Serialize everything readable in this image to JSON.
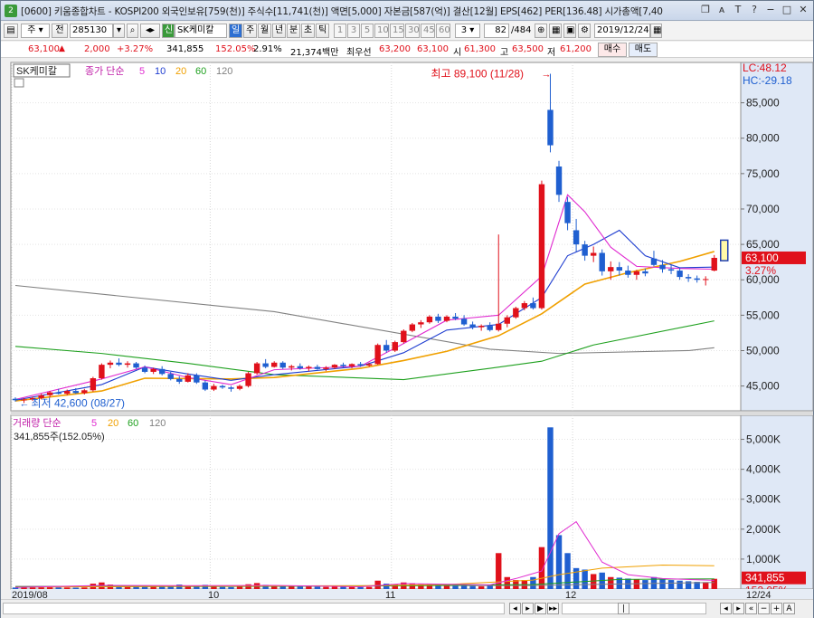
{
  "title": "[0600] 키움종합차트 - KOSPI200 외국인보유[759(천)] 주식수[11,741(천)] 액면[5,000] 자본금[587(억)] 결산[12월] EPS[462] PER[136.48] 시가총액[7,40",
  "window_num": "2",
  "toolbar": {
    "period_mode": "주",
    "jeon": "전",
    "code": "285130",
    "badge": "신",
    "name": "SK케미칼",
    "day": "일",
    "week": "주",
    "month": "월",
    "year": "년",
    "minute": "분",
    "second": "초",
    "tick": "틱",
    "intervals": [
      "1",
      "3",
      "5",
      "10",
      "15",
      "30",
      "45",
      "60"
    ],
    "interval_sel": "3",
    "count": "82",
    "total": "/484",
    "date": "2019/12/24",
    "buy": "매수",
    "sell": "매도"
  },
  "info": {
    "price": "63,100",
    "arrow": "▲",
    "change": "2,000",
    "pct": "+3.27%",
    "volume": "341,855",
    "vol_ratio": "152.05%",
    "turnover": "2.91%",
    "amount": "21,374백만",
    "best_label": "최우선",
    "bid1": "63,200",
    "bid2": "63,100",
    "open_label": "시",
    "open": "61,300",
    "high_label": "고",
    "high": "63,500",
    "low_label": "저",
    "low": "61,200"
  },
  "price_panel": {
    "name_box": "SK케미칼",
    "legend_prefix": "종가 단순",
    "ma": [
      "5",
      "10",
      "20",
      "60",
      "120"
    ],
    "lc": "LC:48.12",
    "hc": "HC:-29.18",
    "max_label": "최고 89,100 (11/28)",
    "min_label": "최저 42,600 (08/27)",
    "cur_price": "63,100",
    "cur_pct": "3.27%"
  },
  "volume_panel": {
    "legend_prefix": "거래량 단순",
    "ma": [
      "5",
      "20",
      "60",
      "120"
    ],
    "cur_text": "341,855주(152.05%)",
    "cur_vol": "341,855",
    "cur_pct": "152.05%"
  },
  "x_labels": [
    "2019/08",
    "10",
    "11",
    "12",
    "12/24"
  ],
  "colors": {
    "up": "#e0111b",
    "down": "#1f5fd0",
    "ma5": "#e02ad0",
    "ma10": "#1e3dd0",
    "ma20": "#f0a000",
    "ma60": "#1ea01e",
    "ma120": "#808080"
  },
  "chart_data": {
    "type": "candlestick",
    "price_axis": {
      "ticks": [
        45000,
        50000,
        55000,
        60000,
        65000,
        70000,
        75000,
        80000,
        85000
      ],
      "tick_labels": [
        "45,000",
        "50,000",
        "55,000",
        "60,000",
        "65,000",
        "70,000",
        "75,000",
        "80,000",
        "85,000"
      ],
      "range": [
        41500,
        90700
      ]
    },
    "volume_axis": {
      "ticks": [
        1000000,
        2000000,
        3000000,
        4000000,
        5000000
      ],
      "tick_labels": [
        "1,000K",
        "2,000K",
        "3,000K",
        "4,000K",
        "5,000K"
      ],
      "range": [
        0,
        5500000
      ]
    },
    "candles": [
      [
        43200,
        43400,
        42800,
        43000
      ],
      [
        43000,
        43300,
        42600,
        43100
      ],
      [
        43100,
        43500,
        42900,
        43300
      ],
      [
        43300,
        43900,
        43100,
        43700
      ],
      [
        43700,
        44300,
        43400,
        44100
      ],
      [
        44100,
        44600,
        43800,
        43900
      ],
      [
        43900,
        44500,
        43700,
        44300
      ],
      [
        44300,
        44700,
        43900,
        44000
      ],
      [
        44000,
        44600,
        43800,
        44400
      ],
      [
        44400,
        46300,
        44200,
        46100
      ],
      [
        46100,
        48200,
        45900,
        48000
      ],
      [
        48000,
        48600,
        47500,
        48300
      ],
      [
        48300,
        48900,
        47800,
        48000
      ],
      [
        48000,
        48500,
        47600,
        48200
      ],
      [
        48200,
        48400,
        47400,
        47600
      ],
      [
        47600,
        47900,
        46800,
        47000
      ],
      [
        47000,
        47600,
        46700,
        47400
      ],
      [
        47400,
        47800,
        46500,
        46700
      ],
      [
        46700,
        47000,
        45800,
        46000
      ],
      [
        46000,
        46400,
        45300,
        45600
      ],
      [
        45600,
        46800,
        45500,
        46500
      ],
      [
        46500,
        46800,
        45300,
        45500
      ],
      [
        45500,
        45800,
        44300,
        44500
      ],
      [
        44500,
        45300,
        44300,
        45000
      ],
      [
        45000,
        45200,
        44600,
        44800
      ],
      [
        44800,
        45000,
        44200,
        44600
      ],
      [
        44600,
        45200,
        44400,
        45000
      ],
      [
        45000,
        47000,
        44800,
        46800
      ],
      [
        46800,
        48400,
        46600,
        48200
      ],
      [
        48200,
        48800,
        47500,
        47700
      ],
      [
        47700,
        48500,
        47600,
        48300
      ],
      [
        48300,
        48500,
        47400,
        47600
      ],
      [
        47600,
        48000,
        47200,
        47800
      ],
      [
        47800,
        48200,
        47300,
        47500
      ],
      [
        47500,
        47900,
        47100,
        47700
      ],
      [
        47700,
        48000,
        47300,
        47400
      ],
      [
        47400,
        47800,
        47100,
        47600
      ],
      [
        47600,
        48100,
        47400,
        48000
      ],
      [
        48000,
        48300,
        47600,
        47800
      ],
      [
        47800,
        48200,
        47500,
        48100
      ],
      [
        48100,
        48400,
        47700,
        47900
      ],
      [
        47900,
        48300,
        47700,
        48100
      ],
      [
        48100,
        51000,
        48000,
        50800
      ],
      [
        50800,
        51500,
        49700,
        50000
      ],
      [
        50000,
        51400,
        49800,
        51200
      ],
      [
        51200,
        53000,
        51000,
        52800
      ],
      [
        52800,
        53900,
        52600,
        53700
      ],
      [
        53700,
        54300,
        53200,
        54000
      ],
      [
        54000,
        55000,
        53800,
        54800
      ],
      [
        54800,
        55200,
        53900,
        54200
      ],
      [
        54200,
        55000,
        54000,
        54800
      ],
      [
        54800,
        55300,
        54300,
        54500
      ],
      [
        54500,
        55000,
        53500,
        53700
      ],
      [
        53700,
        54100,
        53000,
        53300
      ],
      [
        53300,
        53700,
        52800,
        53500
      ],
      [
        53500,
        54000,
        52700,
        52900
      ],
      [
        52900,
        66400,
        52700,
        53800
      ],
      [
        53800,
        55000,
        53300,
        54700
      ],
      [
        54700,
        56200,
        54500,
        56000
      ],
      [
        56000,
        57000,
        55700,
        56700
      ],
      [
        56700,
        57500,
        55800,
        56000
      ],
      [
        56000,
        74000,
        55800,
        73500
      ],
      [
        84000,
        89100,
        78000,
        79000
      ],
      [
        76000,
        76800,
        71000,
        72000
      ],
      [
        71000,
        71700,
        67000,
        68000
      ],
      [
        67000,
        68600,
        64000,
        65000
      ],
      [
        65000,
        65500,
        62700,
        63400
      ],
      [
        63400,
        64700,
        62500,
        63800
      ],
      [
        63800,
        64300,
        60600,
        61200
      ],
      [
        61200,
        62600,
        60000,
        61800
      ],
      [
        61800,
        62500,
        60600,
        61300
      ],
      [
        61300,
        62000,
        60300,
        60700
      ],
      [
        60700,
        61400,
        60000,
        61200
      ],
      [
        61200,
        61600,
        60500,
        60900
      ],
      [
        63000,
        64100,
        61900,
        62100
      ],
      [
        62100,
        62800,
        61000,
        61500
      ],
      [
        61500,
        62100,
        60800,
        61300
      ],
      [
        61300,
        61700,
        60000,
        60400
      ],
      [
        60400,
        60800,
        59700,
        60200
      ],
      [
        60200,
        60600,
        59600,
        60000
      ],
      [
        60000,
        60500,
        59200,
        60100
      ],
      [
        61300,
        63500,
        61200,
        63100
      ]
    ],
    "volumes": [
      50000,
      45000,
      55000,
      60000,
      70000,
      55000,
      50000,
      45000,
      52000,
      180000,
      220000,
      150000,
      110000,
      95000,
      90000,
      85000,
      80000,
      95000,
      120000,
      150000,
      120000,
      100000,
      140000,
      90000,
      70000,
      65000,
      80000,
      160000,
      200000,
      140000,
      100000,
      120000,
      90000,
      80000,
      85000,
      75000,
      70000,
      80000,
      75000,
      70000,
      65000,
      70000,
      280000,
      180000,
      160000,
      220000,
      190000,
      160000,
      170000,
      130000,
      140000,
      110000,
      120000,
      100000,
      90000,
      110000,
      1200000,
      400000,
      300000,
      300000,
      400000,
      1400000,
      5400000,
      1800000,
      1200000,
      700000,
      650000,
      500000,
      550000,
      400000,
      380000,
      350000,
      330000,
      300000,
      400000,
      330000,
      300000,
      280000,
      260000,
      240000,
      230000,
      341855
    ],
    "ma_lines": {
      "ma120": [
        [
          0,
          59200
        ],
        [
          30,
          55500
        ],
        [
          55,
          50200
        ],
        [
          63,
          49600
        ],
        [
          78,
          50000
        ],
        [
          81,
          50400
        ]
      ],
      "ma60": [
        [
          0,
          50600
        ],
        [
          10,
          49600
        ],
        [
          20,
          48200
        ],
        [
          30,
          46600
        ],
        [
          45,
          45900
        ],
        [
          55,
          47500
        ],
        [
          61,
          48500
        ],
        [
          67,
          50800
        ],
        [
          81,
          54200
        ]
      ],
      "ma20": [
        [
          0,
          42900
        ],
        [
          10,
          44300
        ],
        [
          15,
          46100
        ],
        [
          25,
          46000
        ],
        [
          30,
          46200
        ],
        [
          40,
          47500
        ],
        [
          45,
          48600
        ],
        [
          50,
          49900
        ],
        [
          56,
          52100
        ],
        [
          61,
          55200
        ],
        [
          66,
          59400
        ],
        [
          71,
          61000
        ],
        [
          77,
          62600
        ],
        [
          81,
          64000
        ]
      ],
      "ma10": [
        [
          0,
          43000
        ],
        [
          10,
          45200
        ],
        [
          15,
          47700
        ],
        [
          20,
          46700
        ],
        [
          25,
          45800
        ],
        [
          30,
          46600
        ],
        [
          40,
          47800
        ],
        [
          45,
          49700
        ],
        [
          50,
          52900
        ],
        [
          56,
          53700
        ],
        [
          61,
          57500
        ],
        [
          64,
          63400
        ],
        [
          67,
          65000
        ],
        [
          70,
          67000
        ],
        [
          73,
          63400
        ],
        [
          77,
          61700
        ],
        [
          81,
          61800
        ]
      ],
      "ma5": [
        [
          0,
          43100
        ],
        [
          10,
          46000
        ],
        [
          15,
          47700
        ],
        [
          20,
          46200
        ],
        [
          25,
          45200
        ],
        [
          30,
          47300
        ],
        [
          40,
          47800
        ],
        [
          45,
          51000
        ],
        [
          50,
          54300
        ],
        [
          56,
          55000
        ],
        [
          61,
          60500
        ],
        [
          62,
          64300
        ],
        [
          64,
          72000
        ],
        [
          66,
          69600
        ],
        [
          69,
          64600
        ],
        [
          72,
          61900
        ],
        [
          77,
          61600
        ],
        [
          81,
          61500
        ]
      ]
    },
    "volume_ma": {
      "ma5": [
        [
          0,
          53000
        ],
        [
          10,
          120000
        ],
        [
          20,
          115000
        ],
        [
          30,
          120000
        ],
        [
          40,
          75000
        ],
        [
          45,
          180000
        ],
        [
          55,
          140000
        ],
        [
          58,
          350000
        ],
        [
          61,
          600000
        ],
        [
          63,
          1850000
        ],
        [
          65,
          2250000
        ],
        [
          68,
          900000
        ],
        [
          71,
          480000
        ],
        [
          75,
          350000
        ],
        [
          81,
          290000
        ]
      ],
      "ma20": [
        [
          0,
          60000
        ],
        [
          20,
          95000
        ],
        [
          40,
          110000
        ],
        [
          50,
          150000
        ],
        [
          60,
          300000
        ],
        [
          63,
          480000
        ],
        [
          68,
          700000
        ],
        [
          75,
          800000
        ],
        [
          81,
          780000
        ]
      ],
      "ma60": [
        [
          0,
          70000
        ],
        [
          40,
          100000
        ],
        [
          60,
          150000
        ],
        [
          70,
          320000
        ],
        [
          81,
          340000
        ]
      ],
      "ma120": [
        [
          0,
          90000
        ],
        [
          60,
          120000
        ],
        [
          81,
          220000
        ]
      ]
    },
    "max_index": 62,
    "min_index": 1
  }
}
